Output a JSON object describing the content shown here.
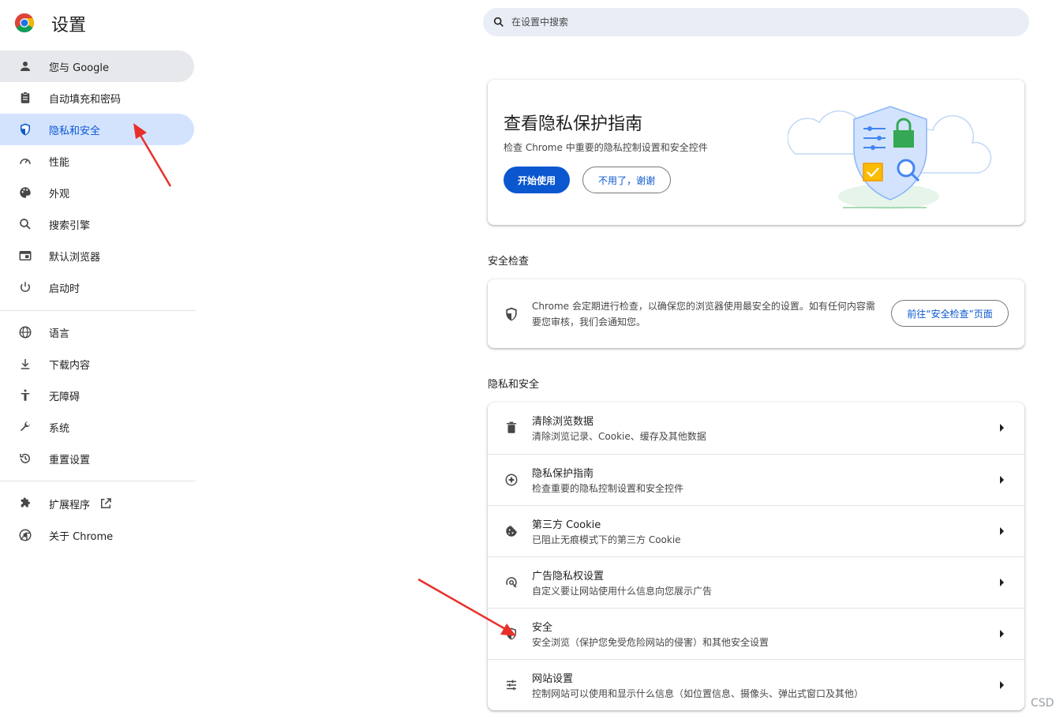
{
  "header": {
    "title": "设置",
    "search_placeholder": "在设置中搜索"
  },
  "sidebar": {
    "items": [
      {
        "label": "您与 Google",
        "icon": "person-icon"
      },
      {
        "label": "自动填充和密码",
        "icon": "clipboard-icon"
      },
      {
        "label": "隐私和安全",
        "icon": "shield-icon"
      },
      {
        "label": "性能",
        "icon": "speedometer-icon"
      },
      {
        "label": "外观",
        "icon": "palette-icon"
      },
      {
        "label": "搜索引擎",
        "icon": "search-icon"
      },
      {
        "label": "默认浏览器",
        "icon": "browser-window-icon"
      },
      {
        "label": "启动时",
        "icon": "power-icon"
      },
      {
        "label": "语言",
        "icon": "globe-icon"
      },
      {
        "label": "下载内容",
        "icon": "download-icon"
      },
      {
        "label": "无障碍",
        "icon": "accessibility-icon"
      },
      {
        "label": "系统",
        "icon": "wrench-icon"
      },
      {
        "label": "重置设置",
        "icon": "history-icon"
      },
      {
        "label": "扩展程序",
        "icon": "puzzle-icon"
      },
      {
        "label": "关于 Chrome",
        "icon": "chrome-icon"
      }
    ]
  },
  "privacy_guide": {
    "title": "查看隐私保护指南",
    "subtitle": "检查 Chrome 中重要的隐私控制设置和安全控件",
    "start_button": "开始使用",
    "dismiss_button": "不用了，谢谢"
  },
  "safety_check": {
    "label": "安全检查",
    "text": "Chrome 会定期进行检查，以确保您的浏览器使用最安全的设置。如有任何内容需要您审核，我们会通知您。",
    "button": "前往“安全检查”页面"
  },
  "privacy_section": {
    "label": "隐私和安全",
    "rows": [
      {
        "title": "清除浏览数据",
        "subtitle": "清除浏览记录、Cookie、缓存及其他数据",
        "icon": "trash-icon"
      },
      {
        "title": "隐私保护指南",
        "subtitle": "检查重要的隐私控制设置和安全控件",
        "icon": "compass-icon"
      },
      {
        "title": "第三方 Cookie",
        "subtitle": "已阻止无痕模式下的第三方 Cookie",
        "icon": "cookie-icon"
      },
      {
        "title": "广告隐私权设置",
        "subtitle": "自定义要让网站使用什么信息向您展示广告",
        "icon": "ad-privacy-icon"
      },
      {
        "title": "安全",
        "subtitle": "安全浏览（保护您免受危险网站的侵害）和其他安全设置",
        "icon": "shield-half-icon"
      },
      {
        "title": "网站设置",
        "subtitle": "控制网站可以使用和显示什么信息（如位置信息、摄像头、弹出式窗口及其他）",
        "icon": "sliders-icon"
      }
    ]
  },
  "watermark": "CSD",
  "colors": {
    "accent": "#0b57d0",
    "active_bg": "#d3e3fd",
    "annotation_red": "#e8302a"
  }
}
